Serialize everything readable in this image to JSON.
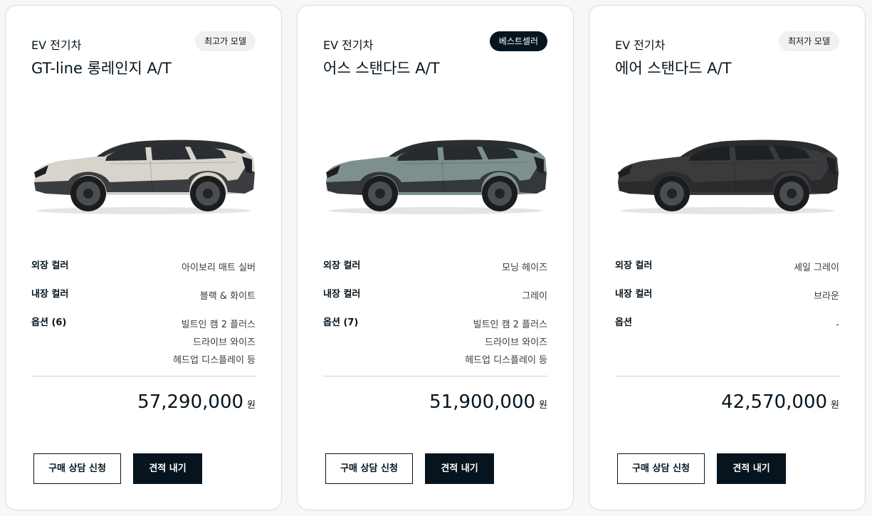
{
  "cards": [
    {
      "type": "EV 전기차",
      "badge": "최고가 모델",
      "badge_style": "light",
      "name": "GT-line 롱레인지 A/T",
      "car_colors": {
        "body": "#d8d4cb",
        "lower": "#3b3d40",
        "glass": "#2a2e33",
        "roof": "#2c2f33"
      },
      "exterior_label": "외장 컬러",
      "exterior_value": "아이보리 매트 실버",
      "interior_label": "내장 컬러",
      "interior_value": "블랙 & 화이트",
      "options_label": "옵션 (6)",
      "options_values": [
        "빌트인 캠 2 플러스",
        "드라이브 와이즈",
        "헤드업 디스플레이 등"
      ],
      "price": "57,290,000",
      "price_unit": "원",
      "consult_button": "구매 상담 신청",
      "estimate_button": "견적 내기"
    },
    {
      "type": "EV 전기차",
      "badge": "베스트셀러",
      "badge_style": "dark",
      "name": "어스 스탠다드 A/T",
      "car_colors": {
        "body": "#7e908d",
        "lower": "#34383b",
        "glass": "#262b30",
        "roof": "#2a2f33"
      },
      "exterior_label": "외장 컬러",
      "exterior_value": "모닝 헤이즈",
      "interior_label": "내장 컬러",
      "interior_value": "그레이",
      "options_label": "옵션 (7)",
      "options_values": [
        "빌트인 캠 2 플러스",
        "드라이브 와이즈",
        "헤드업 디스플레이 등"
      ],
      "price": "51,900,000",
      "price_unit": "원",
      "consult_button": "구매 상담 신청",
      "estimate_button": "견적 내기"
    },
    {
      "type": "EV 전기차",
      "badge": "최저가 모델",
      "badge_style": "light",
      "name": "에어 스탠다드 A/T",
      "car_colors": {
        "body": "#3a3b3d",
        "lower": "#2a2b2d",
        "glass": "#1e2124",
        "roof": "#2b2c2e"
      },
      "exterior_label": "외장 컬러",
      "exterior_value": "셰일 그레이",
      "interior_label": "내장 컬러",
      "interior_value": "브라운",
      "options_label": "옵션",
      "options_values": [
        "-"
      ],
      "price": "42,570,000",
      "price_unit": "원",
      "consult_button": "구매 상담 신청",
      "estimate_button": "견적 내기"
    }
  ]
}
